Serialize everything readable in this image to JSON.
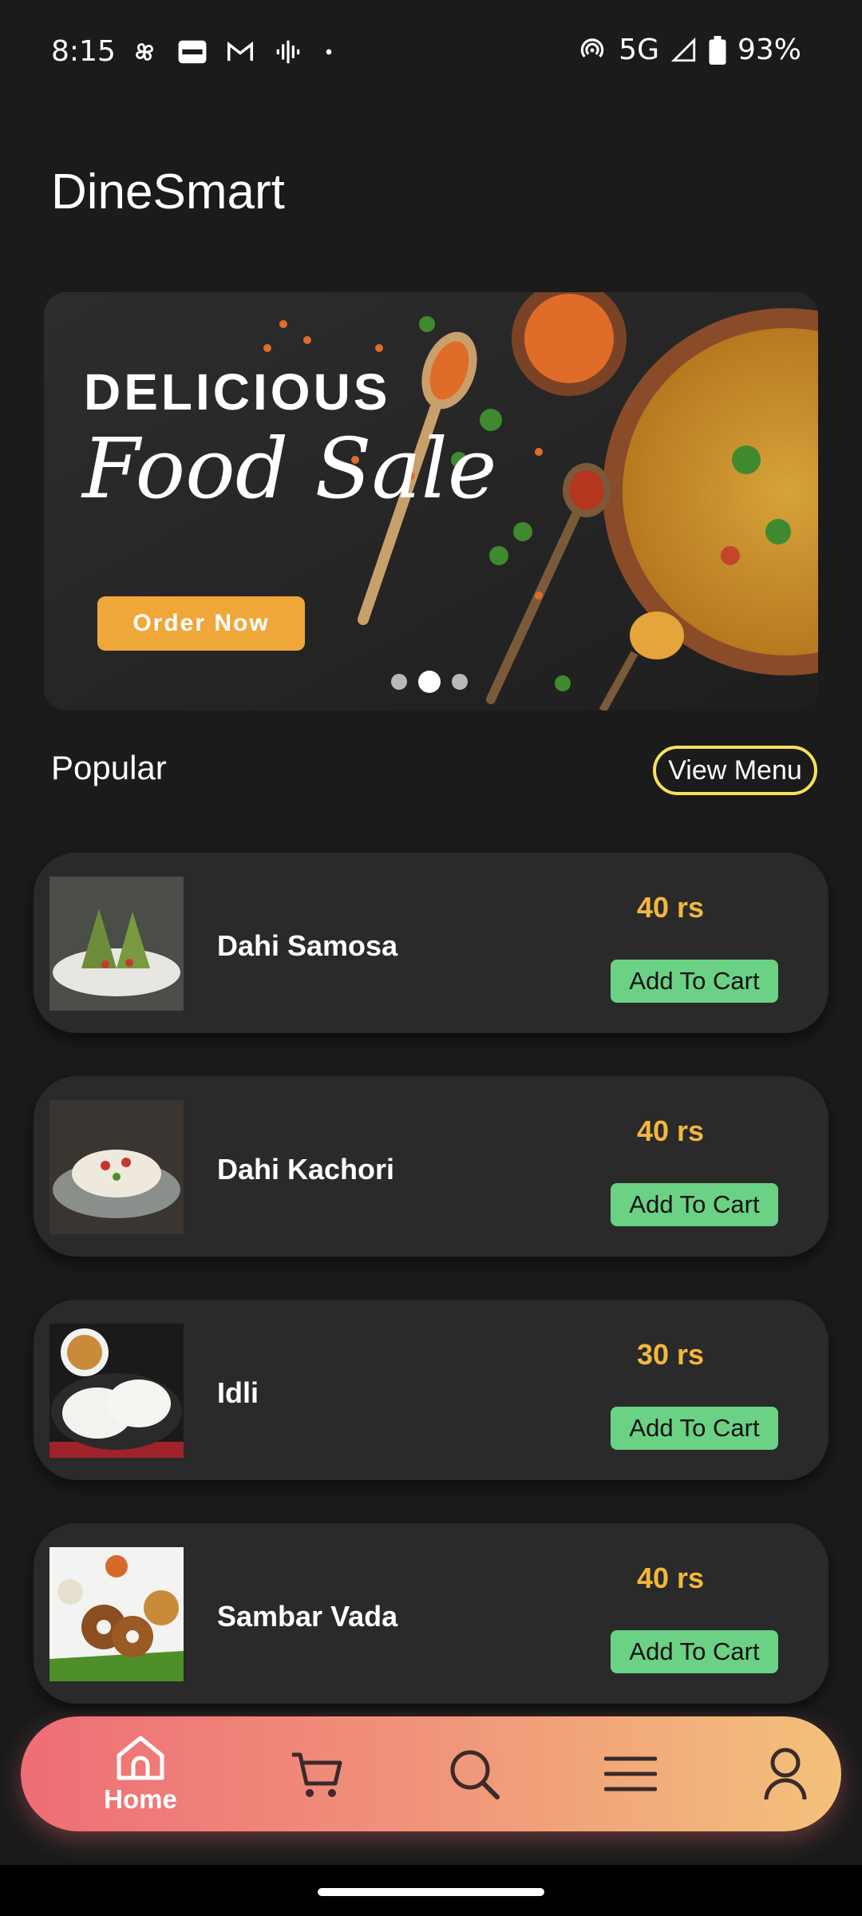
{
  "status_bar": {
    "time": "8:15",
    "left_icons": [
      "pinwheel-icon",
      "paytm-icon",
      "gmail-icon",
      "voice-icon",
      "dot-icon"
    ],
    "network": "5G",
    "battery": "93%"
  },
  "app": {
    "title": "DineSmart"
  },
  "banner": {
    "headline": "DELICIOUS",
    "script": "Food Sale",
    "cta": "Order Now",
    "slides": 3,
    "active_slide": 2
  },
  "popular": {
    "title": "Popular",
    "view_menu": "View Menu",
    "items": [
      {
        "name": "Dahi Samosa",
        "price": "40 rs",
        "button": "Add To Cart"
      },
      {
        "name": "Dahi Kachori",
        "price": "40 rs",
        "button": "Add To Cart"
      },
      {
        "name": "Idli",
        "price": "30 rs",
        "button": "Add To Cart"
      },
      {
        "name": "Sambar Vada",
        "price": "40 rs",
        "button": "Add To Cart"
      }
    ]
  },
  "bottom_nav": {
    "home_label": "Home",
    "items": [
      "home-icon",
      "cart-icon",
      "search-icon",
      "menu-icon",
      "profile-icon"
    ]
  },
  "colors": {
    "background": "#1b1b1b",
    "card": "#2a2a2a",
    "price": "#f3b73b",
    "add_button": "#6ad185",
    "accent_outline": "#f5e25a",
    "nav_gradient_start": "#ee6e76",
    "nav_gradient_end": "#f3c17b"
  }
}
